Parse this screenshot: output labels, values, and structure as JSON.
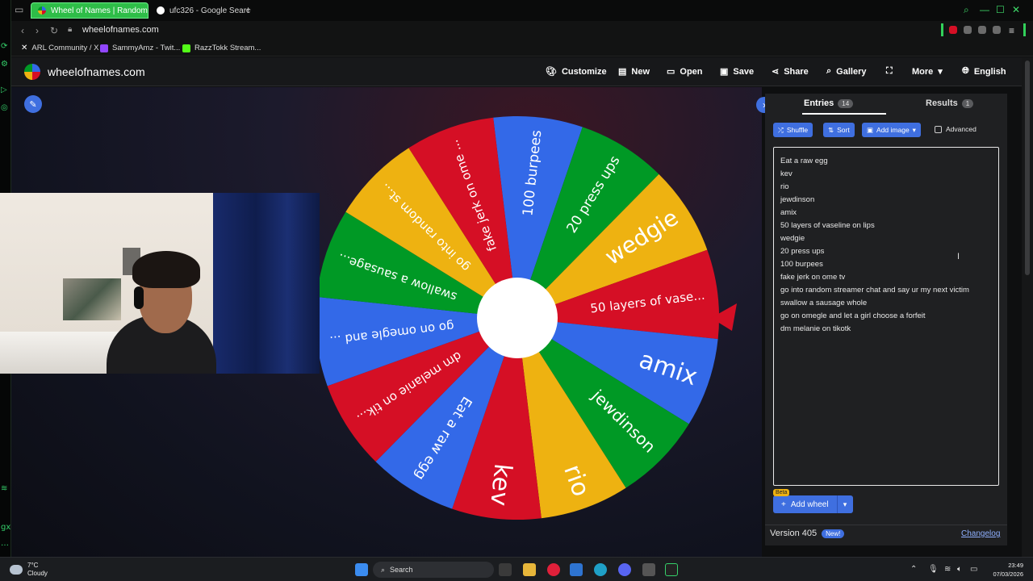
{
  "browser": {
    "tabs": [
      {
        "label": "Wheel of Names | Random",
        "active": true,
        "color": "#2ebd48"
      },
      {
        "label": "ufc326 - Google Search",
        "active": false,
        "color": "#ffffff"
      }
    ],
    "new_tab_icon": "plus-icon",
    "url": "wheelofnames.com",
    "bookmarks": [
      {
        "label": "ARL Community / X",
        "icon": "x-icon"
      },
      {
        "label": "SammyAmz - Twit...",
        "icon": "twitch-icon"
      },
      {
        "label": "RazzTokk Stream...",
        "icon": "kick-icon"
      }
    ],
    "gutter_labels": [
      "⟳",
      "⚙",
      "▷",
      "◎",
      "≋",
      "gx",
      "…"
    ]
  },
  "site": {
    "brand": "wheelofnames.com",
    "menu": [
      {
        "label": "Customize",
        "icon": "palette-icon"
      },
      {
        "label": "New",
        "icon": "document-icon"
      },
      {
        "label": "Open",
        "icon": "folder-icon"
      },
      {
        "label": "Save",
        "icon": "floppy-icon"
      },
      {
        "label": "Share",
        "icon": "share-icon"
      },
      {
        "label": "Gallery",
        "icon": "search-icon"
      },
      {
        "label": "",
        "icon": "fullscreen-icon"
      },
      {
        "label": "More",
        "icon": "chevron-down-icon"
      },
      {
        "label": "English",
        "icon": "globe-icon"
      }
    ]
  },
  "wheel": {
    "colors": {
      "blue": "#3369e8",
      "red": "#d50f25",
      "yellow": "#eeb211",
      "green": "#009925"
    },
    "segments": [
      {
        "label": "100 burpees",
        "color": "#3369e8"
      },
      {
        "label": "20 press ups",
        "color": "#009925"
      },
      {
        "label": "wedgie",
        "color": "#eeb211"
      },
      {
        "label": "50 layers of vase...",
        "color": "#d50f25"
      },
      {
        "label": "amix",
        "color": "#3369e8"
      },
      {
        "label": "jewdinson",
        "color": "#009925"
      },
      {
        "label": "rio",
        "color": "#eeb211"
      },
      {
        "label": "kev",
        "color": "#d50f25"
      },
      {
        "label": "Eat a raw egg",
        "color": "#3369e8"
      },
      {
        "label": "dm melanie on tik...",
        "color": "#d50f25"
      },
      {
        "label": "go on omegle and ...",
        "color": "#3369e8"
      },
      {
        "label": "swallow a sausage...",
        "color": "#009925"
      },
      {
        "label": "go into random st...",
        "color": "#eeb211"
      },
      {
        "label": "fake jerk on ome ...",
        "color": "#d50f25"
      }
    ]
  },
  "panel": {
    "tabs": [
      {
        "label": "Entries",
        "count": "14"
      },
      {
        "label": "Results",
        "count": "1"
      }
    ],
    "buttons": {
      "shuffle": "Shuffle",
      "sort": "Sort",
      "add_image": "Add image",
      "advanced": "Advanced"
    },
    "entries": [
      "Eat a raw egg",
      "kev",
      "rio",
      "jewdinson",
      "amix",
      "50 layers of vaseline on lips",
      "wedgie",
      "20 press ups",
      "100 burpees",
      "fake jerk on ome tv",
      "go into random streamer chat and say ur my next victim",
      "swallow a sausage whole",
      "go on omegle and let a girl choose a forfeit",
      "dm melanie on tikotk"
    ],
    "beta": "Beta",
    "add_wheel": "Add wheel",
    "version": "Version 405",
    "new_badge": "New!",
    "changelog": "Changelog"
  },
  "taskbar": {
    "temp": "7°C",
    "weather": "Cloudy",
    "search": "Search",
    "time": "23:49",
    "date": "07/03/2026"
  }
}
